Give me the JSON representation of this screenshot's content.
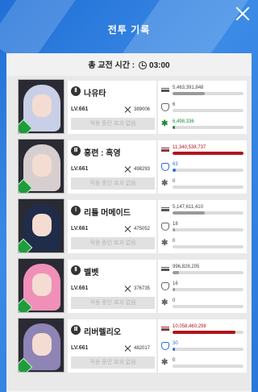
{
  "window": {
    "title": "전투 기록"
  },
  "timer": {
    "label": "총 교전 시간 :",
    "value": "03:00"
  },
  "colors": {
    "accent": "#2a77db",
    "win_damage": "#9a9a9a",
    "damage_red": "#b3141d",
    "heal_green": "#1b8a3a",
    "shield_blue": "#2a6fd6"
  },
  "rows": [
    {
      "name": "나유타",
      "tier": "Ⅱ",
      "level": "LV.661",
      "power": "389006",
      "status": "적용 중인 효과 없음",
      "damage": "5,463,391,848",
      "damage_pct": 0.45,
      "taken": "6",
      "taken_pct": 0.0,
      "heal": "6,498,336",
      "heal_pct": 0.02,
      "hair": "#c9cfe6",
      "highlight": false
    },
    {
      "name": "홍련 : 흑영",
      "tier": "Ⅲ",
      "level": "LV.661",
      "power": "498293",
      "status": "적용 중인 효과 없음",
      "damage": "11,340,538,737",
      "damage_pct": 1.0,
      "taken": "63",
      "taken_pct": 0.05,
      "heal": "0",
      "heal_pct": 0.0,
      "hair": "#d7cfcf",
      "highlight": true
    },
    {
      "name": "리틀 머메이드",
      "tier": "Ⅰ",
      "level": "LV.661",
      "power": "475052",
      "status": "적용 중인 효과 없음",
      "damage": "5,147,611,410",
      "damage_pct": 0.45,
      "taken": "18",
      "taken_pct": 0.02,
      "heal": "0",
      "heal_pct": 0.0,
      "hair": "#1f2c4a",
      "highlight": false
    },
    {
      "name": "벨벳",
      "tier": "Ⅱ",
      "level": "LV.661",
      "power": "376735",
      "status": "적용 중인 효과 없음",
      "damage": "996,828,205",
      "damage_pct": 0.09,
      "taken": "16",
      "taken_pct": 0.02,
      "heal": "0",
      "heal_pct": 0.0,
      "hair": "#f090b8",
      "highlight": false
    },
    {
      "name": "리버렐리오",
      "tier": "Ⅲ",
      "level": "LV.661",
      "power": "482017",
      "status": "적용 중인 효과 없음",
      "damage": "10,058,460,298",
      "damage_pct": 0.89,
      "taken": "30",
      "taken_pct": 0.03,
      "heal": "0",
      "heal_pct": 0.0,
      "hair": "#8f84b6",
      "highlight": true
    }
  ]
}
